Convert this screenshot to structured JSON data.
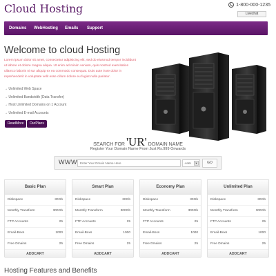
{
  "header": {
    "logo": "Cloud Hosting",
    "phone": "1-800-000-1235",
    "livechat": "Livechat"
  },
  "nav": {
    "items": [
      {
        "label": "Domains"
      },
      {
        "label": "WebHosting"
      },
      {
        "label": "Emails"
      },
      {
        "label": "Support"
      }
    ]
  },
  "hero": {
    "title": "Welcome to cloud Hosting",
    "text": "Lorem ipsum dolor sit amet, consectetur adipisicing elit, sed do eiusmod tempor incididunt ut labore et dolore magna aliqua. Ut enim ad minim veniam, quis nostrud exercitation ullamco laboris ni sur aliquip ex ea commodo consequat. Duis aute irure dolor in reprehenderit in voluptate velit esse cillum dolore eu fugiat nulla pariatur.",
    "features": [
      "Unlimited Web Space",
      "Unlimited Bandwidth (Data Transfer)",
      "Host Unlimited Domains on 1 Account",
      "Unlimited E-mail Accounts"
    ],
    "read_more": "ReadMore",
    "our_plans": "OurPlans"
  },
  "search": {
    "prefix": "SEARCH FOR",
    "big": "'UR'",
    "suffix": "DOMAIN NAME",
    "subtitle": "Register Your Domain Name From Just Rs.999 Onwards",
    "www": "WWW.",
    "placeholder": "Enter Your Dmain Name Here",
    "tld": ".com",
    "go": "GO"
  },
  "plans": [
    {
      "name": "Basic Plan",
      "rows": [
        [
          "Diskspace",
          "30Gb"
        ],
        [
          "Monthly Transform",
          "300Gb"
        ],
        [
          "FTP Accounts",
          "25"
        ],
        [
          "Email-Boxs",
          "1000"
        ],
        [
          "Free Dmains",
          "25"
        ]
      ],
      "cta": "ADDCART"
    },
    {
      "name": "Smart Plan",
      "rows": [
        [
          "Diskspace",
          "30Gb"
        ],
        [
          "Monthly Transform",
          "300Gb"
        ],
        [
          "FTP Accounts",
          "25"
        ],
        [
          "Email-Boxs",
          "1000"
        ],
        [
          "Free Dmains",
          "25"
        ]
      ],
      "cta": "ADDCART"
    },
    {
      "name": "Economy Plan",
      "rows": [
        [
          "Diskspace",
          "30Gb"
        ],
        [
          "Monthly Transform",
          "300Gb"
        ],
        [
          "FTP Accounts",
          "25"
        ],
        [
          "Email-Boxs",
          "1000"
        ],
        [
          "Free Dmains",
          "25"
        ]
      ],
      "cta": "ADDCART"
    },
    {
      "name": "Unlimited Plan",
      "rows": [
        [
          "Diskspace",
          "30Gb"
        ],
        [
          "Monthly Transform",
          "300Gb"
        ],
        [
          "FTP Accounts",
          "25"
        ],
        [
          "Email-Boxs",
          "1000"
        ],
        [
          "Free Dmains",
          "25"
        ]
      ],
      "cta": "ADDCART"
    }
  ],
  "features_section": {
    "title": "Hosting Features and Benefits"
  },
  "colors": {
    "brand_purple": "#5a1466",
    "accent_red": "#e05c6a"
  }
}
